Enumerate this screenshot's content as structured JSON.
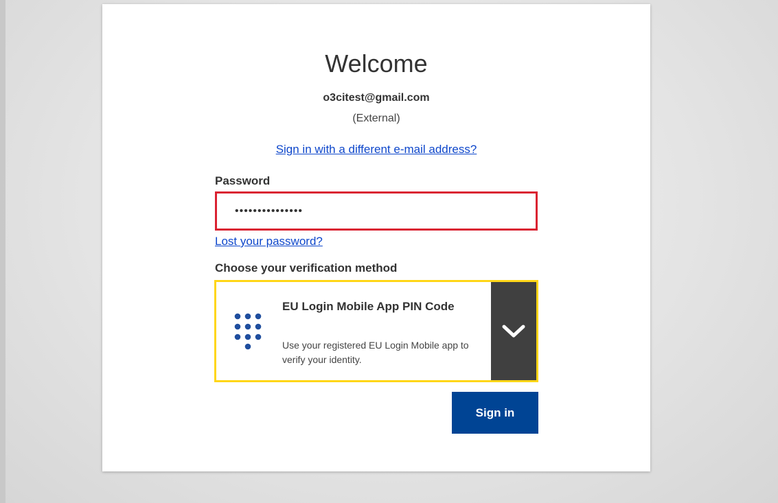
{
  "page": {
    "welcome_title": "Welcome",
    "email": "o3citest@gmail.com",
    "account_type": "(External)",
    "different_email_link": "Sign in with a different e-mail address?"
  },
  "password": {
    "label": "Password",
    "value": "•••••••••••••••",
    "lost_link": "Lost your password?"
  },
  "verification": {
    "label": "Choose your verification method",
    "selected_method": {
      "title": "EU Login Mobile App PIN Code",
      "description": "Use your registered EU Login Mobile app to verify your identity.",
      "icon": "keypad-icon"
    }
  },
  "actions": {
    "sign_in_label": "Sign in"
  },
  "colors": {
    "accent": "#004494",
    "link": "#0e47cb",
    "error_border": "#da2131",
    "method_border": "#ffd617",
    "toggle_bg": "#404040"
  }
}
